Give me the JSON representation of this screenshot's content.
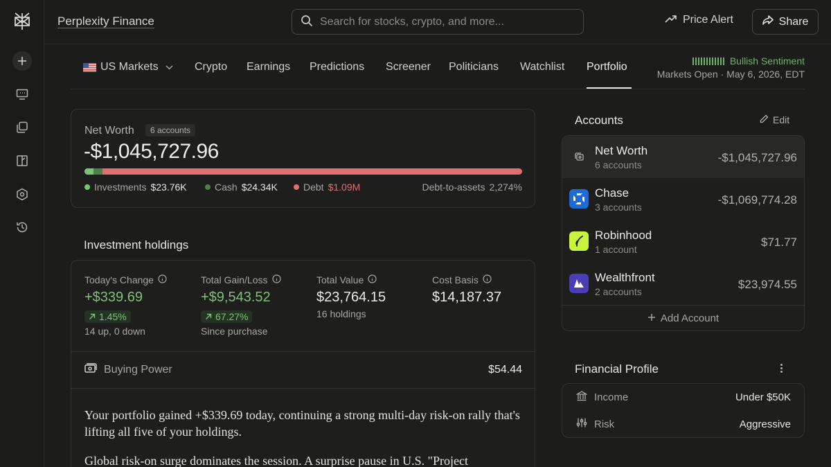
{
  "app": {
    "brand": "Perplexity Finance",
    "search_placeholder": "Search for stocks, crypto, and more...",
    "price_alert_label": "Price Alert",
    "share_label": "Share"
  },
  "rail": {
    "icons": [
      "perplexity-logo-icon",
      "new-thread-icon",
      "discover-icon",
      "spaces-icon",
      "finance-icon",
      "settings-icon",
      "history-icon"
    ]
  },
  "nav": {
    "items": [
      "US Markets",
      "Crypto",
      "Earnings",
      "Predictions",
      "Screener",
      "Politicians",
      "Watchlist",
      "Portfolio"
    ],
    "active": "Portfolio",
    "sentiment": "Bullish Sentiment",
    "market_status": "Markets Open",
    "date": "May 6, 2026, EDT"
  },
  "net_worth": {
    "label": "Net Worth",
    "accounts_badge": "6 accounts",
    "value": "-$1,045,727.96",
    "investments_label": "Investments",
    "investments_value": "$23.76K",
    "cash_label": "Cash",
    "cash_value": "$24.34K",
    "debt_label": "Debt",
    "debt_value": "$1.09M",
    "ratio_label": "Debt-to-assets",
    "ratio_value": "2,274%",
    "bar_fractions": {
      "investments": 0.021,
      "cash": 0.021,
      "debt": 0.958
    }
  },
  "holdings": {
    "title": "Investment holdings",
    "todays_change": {
      "label": "Today's Change",
      "value": "+$339.69",
      "pct": "1.45%",
      "sub": "14 up, 0 down"
    },
    "total_gain": {
      "label": "Total Gain/Loss",
      "value": "+$9,543.52",
      "pct": "67.27%",
      "sub": "Since purchase"
    },
    "total_value": {
      "label": "Total Value",
      "value": "$23,764.15",
      "sub": "16 holdings"
    },
    "cost_basis": {
      "label": "Cost Basis",
      "value": "$14,187.37"
    },
    "buying_power": {
      "label": "Buying Power",
      "value": "$54.44"
    },
    "summary_p1": "Your portfolio gained +$339.69 today, continuing a strong multi-day risk-on rally that's lifting all five of your holdings.",
    "summary_p2": "Global risk-on surge dominates the session. A surprise pause in U.S. \"Project"
  },
  "accounts": {
    "title": "Accounts",
    "edit_label": "Edit",
    "items": [
      {
        "name": "Net Worth",
        "sub": "6 accounts",
        "value": "-$1,045,727.96"
      },
      {
        "name": "Chase",
        "sub": "3 accounts",
        "value": "-$1,069,774.28"
      },
      {
        "name": "Robinhood",
        "sub": "1 account",
        "value": "$71.77"
      },
      {
        "name": "Wealthfront",
        "sub": "2 accounts",
        "value": "$23,974.55"
      }
    ],
    "add_label": "Add Account"
  },
  "profile": {
    "title": "Financial Profile",
    "income_label": "Income",
    "income_value": "Under $50K",
    "risk_label": "Risk",
    "risk_value": "Aggressive"
  },
  "colors": {
    "green": "#7cc475",
    "red": "#df6f72",
    "chase": "#1f6bd6",
    "robinhood": "#c8f53c",
    "wealthfront": "#4b3db5"
  }
}
